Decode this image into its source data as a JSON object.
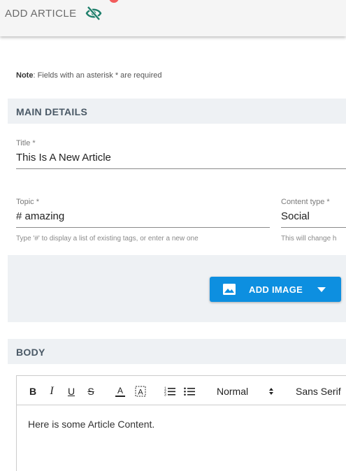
{
  "header": {
    "title": "ADD ARTICLE",
    "visibility_icon": "eye-off-icon",
    "accent_color": "#1e7f6b",
    "notification_color": "#f25c5c"
  },
  "note": {
    "bold": "Note",
    "text": ": Fields with an asterisk * are required"
  },
  "sections": {
    "main_details": "MAIN DETAILS",
    "body": "BODY"
  },
  "fields": {
    "title": {
      "label": "Title *",
      "value": "This Is A New Article"
    },
    "topic": {
      "label": "Topic *",
      "value": "# amazing",
      "helper": "Type '#' to display a list of existing tags, or enter a new one"
    },
    "content_type": {
      "label": "Content type *",
      "value": "Social",
      "helper": "This will change h"
    }
  },
  "image_button": {
    "label": "ADD IMAGE",
    "color": "#0d8fe0",
    "icon": "image-icon",
    "dropdown_icon": "caret-down-icon"
  },
  "editor": {
    "toolbar": {
      "bold": "B",
      "italic": "I",
      "underline": "U",
      "strike": "S",
      "font_color": "A",
      "ordered_list_icon": "ordered-list-icon",
      "bullet_list_icon": "bullet-list-icon",
      "size": "Normal",
      "font": "Sans Serif"
    },
    "content": "Here is some Article Content."
  }
}
